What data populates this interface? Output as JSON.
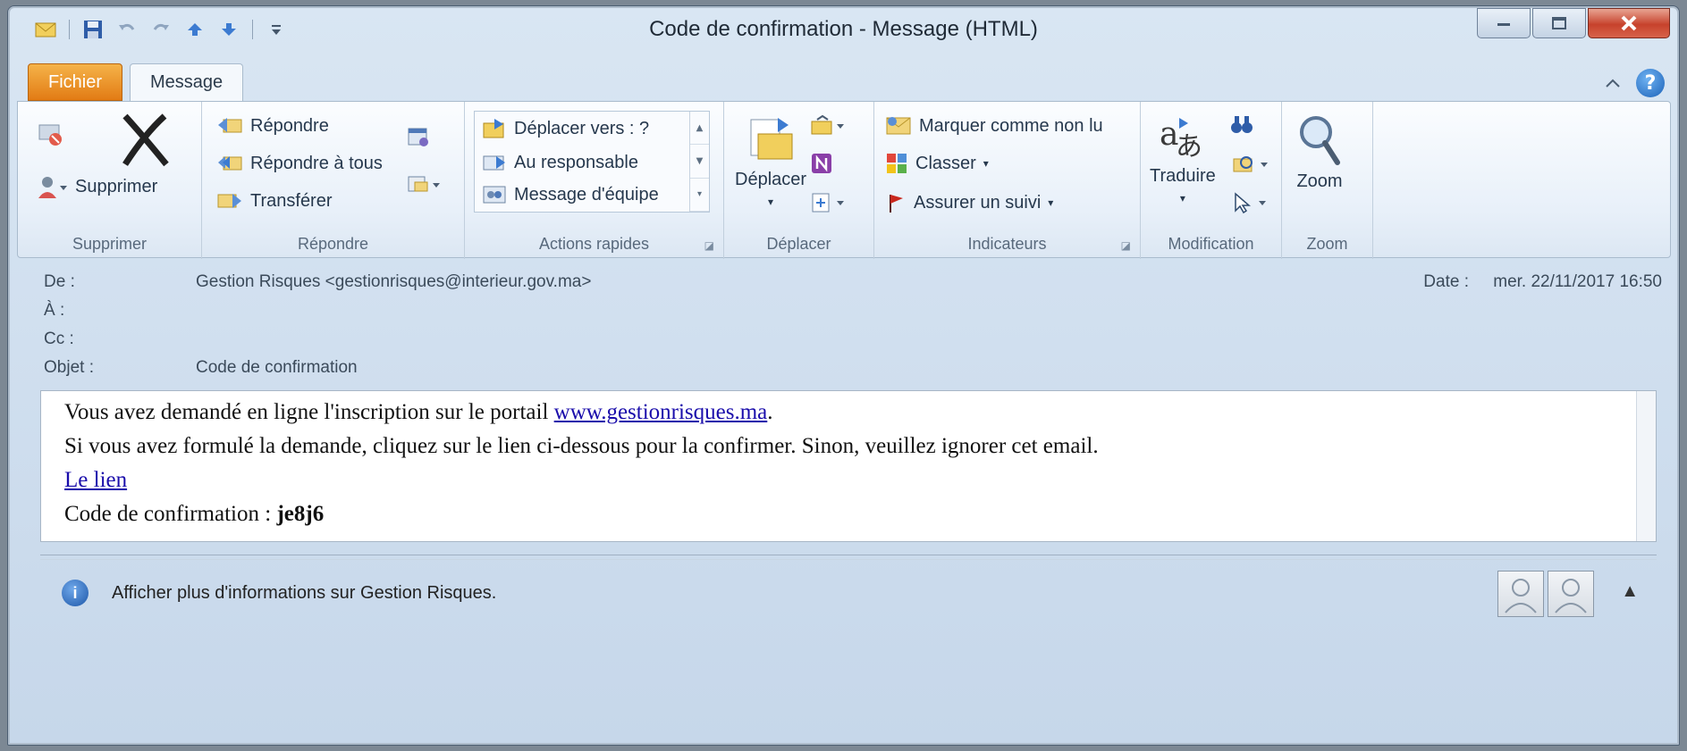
{
  "window": {
    "title": "Code de confirmation - Message (HTML)"
  },
  "quick_access": {
    "icons": [
      "mail-icon",
      "save-icon",
      "undo-icon",
      "redo-icon",
      "up-arrow-icon",
      "down-arrow-icon",
      "customize-icon"
    ]
  },
  "tabs": {
    "file": "Fichier",
    "message": "Message"
  },
  "ribbon": {
    "delete_group": {
      "label": "Supprimer",
      "delete_button": "Supprimer"
    },
    "respond_group": {
      "label": "Répondre",
      "reply": "Répondre",
      "reply_all": "Répondre à tous",
      "forward": "Transférer"
    },
    "quick_steps_group": {
      "label": "Actions rapides",
      "items": [
        "Déplacer vers : ?",
        "Au responsable",
        "Message d'équipe"
      ]
    },
    "move_group": {
      "label": "Déplacer",
      "move_button": "Déplacer"
    },
    "tags_group": {
      "label": "Indicateurs",
      "mark_unread": "Marquer comme non lu",
      "categorize": "Classer",
      "follow_up": "Assurer un suivi"
    },
    "editing_group": {
      "label": "Modification",
      "translate": "Traduire"
    },
    "zoom_group": {
      "label": "Zoom",
      "zoom_button": "Zoom"
    }
  },
  "header": {
    "from_label": "De :",
    "from_value": "Gestion Risques <gestionrisques@interieur.gov.ma>",
    "to_label": "À :",
    "cc_label": "Cc :",
    "subject_label": "Objet :",
    "subject_value": "Code de confirmation",
    "date_label": "Date :",
    "date_value": "mer. 22/11/2017 16:50"
  },
  "body": {
    "line1_prefix": "Vous avez demandé en ligne l'inscription sur le portail ",
    "line1_link": "www.gestionrisques.ma",
    "line1_suffix": ".",
    "line2": "Si vous avez formulé la demande, cliquez sur le lien ci-dessous pour la confirmer. Sinon, veuillez ignorer cet email.",
    "link_text": "Le lien",
    "code_label": "Code de confirmation : ",
    "code_value": "je8j6"
  },
  "people_pane": {
    "info_text": "Afficher plus d'informations sur Gestion Risques."
  },
  "colors": {
    "file_tab": "#e27b14",
    "link": "#1a0dab",
    "close_button": "#c7422c"
  }
}
